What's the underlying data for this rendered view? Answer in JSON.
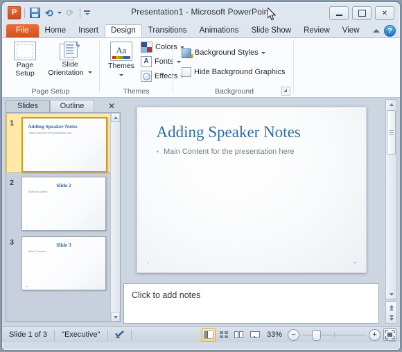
{
  "window": {
    "title": "Presentation1  -  Microsoft PowerPoint",
    "app_icon": "powerpoint-logo-icon",
    "minimize_label": "Minimize",
    "restore_label": "Restore",
    "close_label": "✕"
  },
  "quick_access": {
    "items": [
      {
        "name": "app-menu-icon",
        "label": "P"
      },
      {
        "name": "save-icon",
        "label": "Save"
      },
      {
        "name": "undo-icon",
        "label": "Undo"
      },
      {
        "name": "redo-icon",
        "label": "Redo"
      },
      {
        "name": "customize-qat-icon",
        "label": "Customize Quick Access Toolbar"
      }
    ]
  },
  "ribbon": {
    "tabs": [
      {
        "label": "File",
        "active": false
      },
      {
        "label": "Home",
        "active": false
      },
      {
        "label": "Insert",
        "active": false
      },
      {
        "label": "Design",
        "active": true
      },
      {
        "label": "Transitions",
        "active": false
      },
      {
        "label": "Animations",
        "active": false
      },
      {
        "label": "Slide Show",
        "active": false
      },
      {
        "label": "Review",
        "active": false
      },
      {
        "label": "View",
        "active": false
      }
    ],
    "help_label": "?",
    "groups": {
      "page_setup": {
        "label": "Page Setup",
        "page_setup_button": "Page\nSetup",
        "page_setup_line1": "Page",
        "page_setup_line2": "Setup",
        "slide_orientation_line1": "Slide",
        "slide_orientation_line2": "Orientation"
      },
      "themes": {
        "label": "Themes",
        "themes_button": "Themes",
        "colors_label": "Colors",
        "fonts_label": "Fonts",
        "effects_label": "Effects"
      },
      "background": {
        "label": "Background",
        "background_styles_label": "Background Styles",
        "hide_background_graphics_label": "Hide Background Graphics",
        "hide_background_graphics_checked": false
      }
    }
  },
  "slides_panel": {
    "tabs": [
      {
        "label": "Slides",
        "active": true
      },
      {
        "label": "Outline",
        "active": false
      }
    ],
    "close_label": "✕",
    "thumbnails": [
      {
        "number": "1",
        "title": "Adding Speaker Notes",
        "body": "Main Content for the presentation here",
        "selected": true,
        "title_align": "left"
      },
      {
        "number": "2",
        "title": "Slide 2",
        "body": "Slide two content",
        "selected": false,
        "title_align": "center"
      },
      {
        "number": "3",
        "title": "Slide 3",
        "body": "Slide 3 Content",
        "selected": false,
        "title_align": "center"
      }
    ]
  },
  "slide_editor": {
    "title": "Adding Speaker Notes",
    "bullet_char": "•",
    "bullet_text": "Main Content for the presentation here"
  },
  "notes_pane": {
    "placeholder": "Click to add notes"
  },
  "status_bar": {
    "slide_counter": "Slide 1 of 3",
    "theme_name": "\"Executive\"",
    "spell_check_icon": "spell-check-icon",
    "views": [
      {
        "label": "Normal",
        "icon": "normal-view-icon",
        "active": true
      },
      {
        "label": "Slide Sorter",
        "icon": "slide-sorter-icon",
        "active": false
      },
      {
        "label": "Reading View",
        "icon": "reading-view-icon",
        "active": false
      },
      {
        "label": "Slide Show",
        "icon": "slide-show-icon",
        "active": false
      }
    ],
    "zoom_level": "33%",
    "zoom_out_label": "−",
    "zoom_in_label": "+",
    "fit_to_window_label": "Fit slide to current window"
  },
  "colors": {
    "accent_title_blue": "#2c6ca8",
    "file_tab_orange": "#d2501f",
    "selection_yellow": "#ffe9a8"
  }
}
